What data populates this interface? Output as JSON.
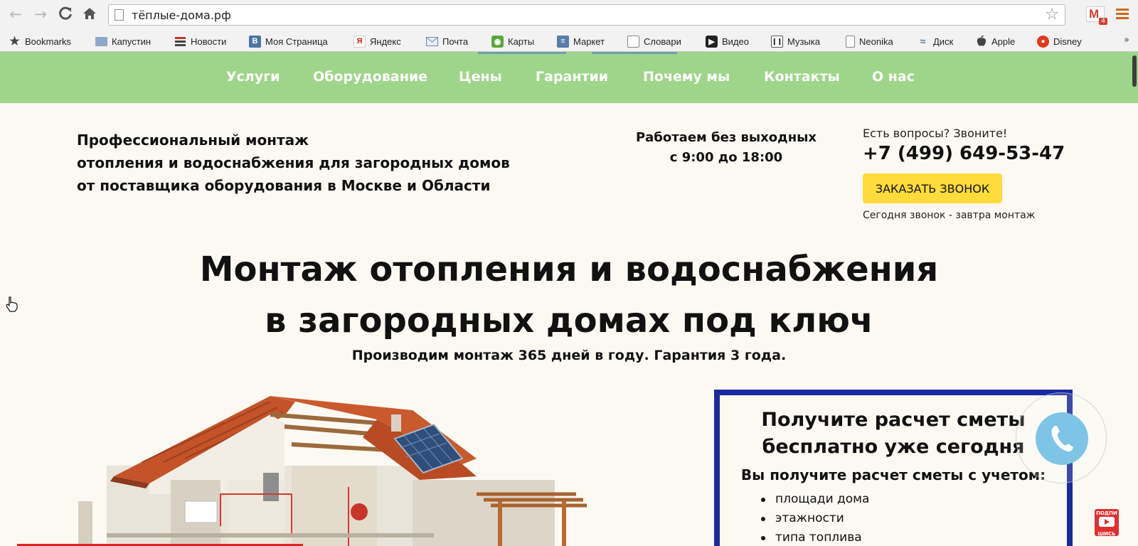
{
  "browser": {
    "url": "тёплые-дома.рф",
    "gmail_badge": "4",
    "bookmarks": [
      {
        "label": "Bookmarks",
        "icon": "star-icon"
      },
      {
        "label": "Капустин",
        "icon": "folder-icon"
      },
      {
        "label": "Новости",
        "icon": "news-icon"
      },
      {
        "label": "Моя Страница",
        "icon": "vk-icon",
        "glyph": "B"
      },
      {
        "label": "Яндекс",
        "icon": "yandex-icon",
        "glyph": "Я"
      },
      {
        "label": "Почта",
        "icon": "mail-icon"
      },
      {
        "label": "Карты",
        "icon": "maps-icon"
      },
      {
        "label": "Маркет",
        "icon": "market-icon"
      },
      {
        "label": "Словари",
        "icon": "dictionary-icon"
      },
      {
        "label": "Видео",
        "icon": "video-icon"
      },
      {
        "label": "Музыка",
        "icon": "music-icon"
      },
      {
        "label": "Neonika",
        "icon": "page-icon"
      },
      {
        "label": "Диск",
        "icon": "disk-icon"
      },
      {
        "label": "Apple",
        "icon": "apple-icon"
      },
      {
        "label": "Disney",
        "icon": "disney-icon"
      }
    ],
    "more_label": "»"
  },
  "nav": {
    "items": [
      "Услуги",
      "Оборудование",
      "Цены",
      "Гарантии",
      "Почему мы",
      "Контакты",
      "О нас"
    ]
  },
  "header": {
    "tagline": [
      "Профессиональный монтаж",
      "отопления и водоснабжения для загородных домов",
      "от поставщика оборудования в Москве и Области"
    ],
    "hours": [
      "Работаем без выходных",
      "с 9:00 до 18:00"
    ],
    "contact_question": "Есть вопросы? Звоните!",
    "phone": "+7 (499) 649-53-47",
    "callback_button": "ЗАКАЗАТЬ ЗВОНОК",
    "callback_note": "Сегодня звонок - завтра монтаж"
  },
  "hero": {
    "title_lines": [
      "Монтаж отопления и водоснабжения",
      "в загородных домах под ключ"
    ],
    "subtitle": "Производим монтаж 365 дней в году. Гарантия 3 года."
  },
  "estimate": {
    "title_lines": [
      "Получите расчет сметы",
      "бесплатно уже сегодня"
    ],
    "lead": "Вы получите расчет сметы с учетом:",
    "items": [
      "площади дома",
      "этажности",
      "типа топлива"
    ]
  },
  "overlay": {
    "subscribe_label": [
      "ПОДПИ",
      "ШИСЬ"
    ]
  },
  "colors": {
    "nav_bg": "#9ed58a",
    "callback_bg": "#ffdb3b",
    "estimate_border": "#1b2aa0",
    "phone_float": "#7ec4e6"
  }
}
